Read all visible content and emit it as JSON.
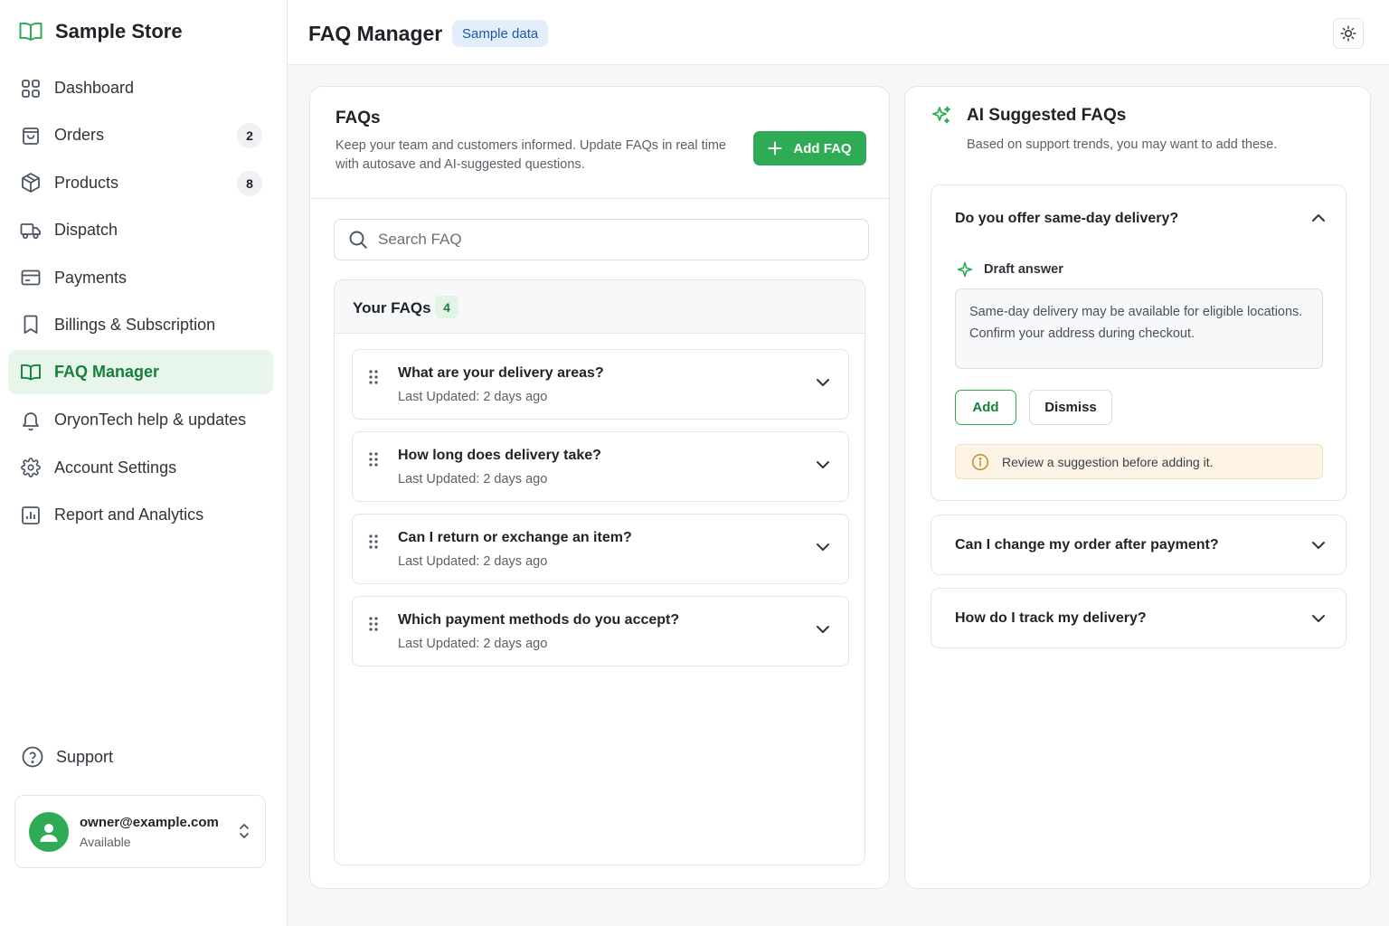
{
  "brand": {
    "name": "Sample Store"
  },
  "sidebar": {
    "items": [
      {
        "label": "Dashboard",
        "icon": "grid-icon"
      },
      {
        "label": "Orders",
        "icon": "shopping-bag-icon",
        "count": "2"
      },
      {
        "label": "Products",
        "icon": "package-icon",
        "count": "8"
      },
      {
        "label": "Dispatch",
        "icon": "truck-icon"
      },
      {
        "label": "Payments",
        "icon": "credit-card-icon"
      },
      {
        "label": "Billings & Subscription",
        "icon": "bookmark-icon"
      },
      {
        "label": "FAQ Manager",
        "icon": "book-open-icon",
        "active": true
      },
      {
        "label": "OryonTech help & updates",
        "icon": "bell-icon"
      },
      {
        "label": "Account Settings",
        "icon": "gear-icon"
      },
      {
        "label": "Report and Analytics",
        "icon": "bar-chart-icon"
      }
    ],
    "support_label": "Support",
    "user": {
      "email": "owner@example.com",
      "status": "Available"
    }
  },
  "header": {
    "title": "FAQ Manager",
    "badge": "Sample data"
  },
  "faq_panel": {
    "title": "FAQs",
    "description": "Keep your team and customers informed. Update FAQs in real time with autosave and AI-suggested questions.",
    "add_button": "Add FAQ",
    "search": {
      "placeholder": "Search FAQ",
      "value": ""
    },
    "list_title": "Your FAQs",
    "count": "4",
    "items": [
      {
        "question": "What are your delivery areas?",
        "updated": "Last Updated: 2 days ago"
      },
      {
        "question": "How long does delivery take?",
        "updated": "Last Updated: 2 days ago"
      },
      {
        "question": "Can I return or exchange an item?",
        "updated": "Last Updated: 2 days ago"
      },
      {
        "question": "Which payment methods do you accept?",
        "updated": "Last Updated: 2 days ago"
      }
    ]
  },
  "ai_panel": {
    "title": "AI Suggested FAQs",
    "description": "Based on support trends, you may want to add these.",
    "expanded": {
      "question": "Do you offer same-day delivery?",
      "draft_label": "Draft answer",
      "draft_text": "Same-day delivery may be available for eligible locations. Confirm your address during checkout.",
      "add_label": "Add",
      "dismiss_label": "Dismiss",
      "notice": "Review a suggestion before adding it."
    },
    "collapsed": [
      {
        "question": "Can I change my order after payment?"
      },
      {
        "question": "How do I track my delivery?"
      }
    ]
  },
  "colors": {
    "accent": "#2faa55",
    "accent_text": "#16803c",
    "badge_bg": "#e3eefb",
    "notice_bg": "#fdf4e6"
  }
}
